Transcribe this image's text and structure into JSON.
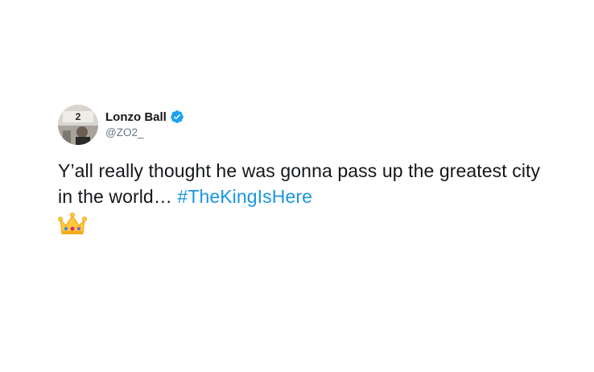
{
  "tweet": {
    "author": {
      "display_name": "Lonzo Ball",
      "handle": "@ZO2_",
      "verified": true,
      "avatar_text": "2"
    },
    "text_before_hashtag": "Y’all really thought he was gonna pass up the greatest city in the world… ",
    "hashtag": "#TheKingIsHere",
    "emoji": "crown"
  },
  "colors": {
    "text": "#14171a",
    "handle": "#657786",
    "link": "#1b95e0",
    "verified_badge": "#1da1f2",
    "crown_gold": "#ffc83d",
    "crown_gem_red": "#e0245e",
    "crown_gem_blue": "#3e8ed0",
    "crown_gem_purple": "#8b5ec2"
  }
}
